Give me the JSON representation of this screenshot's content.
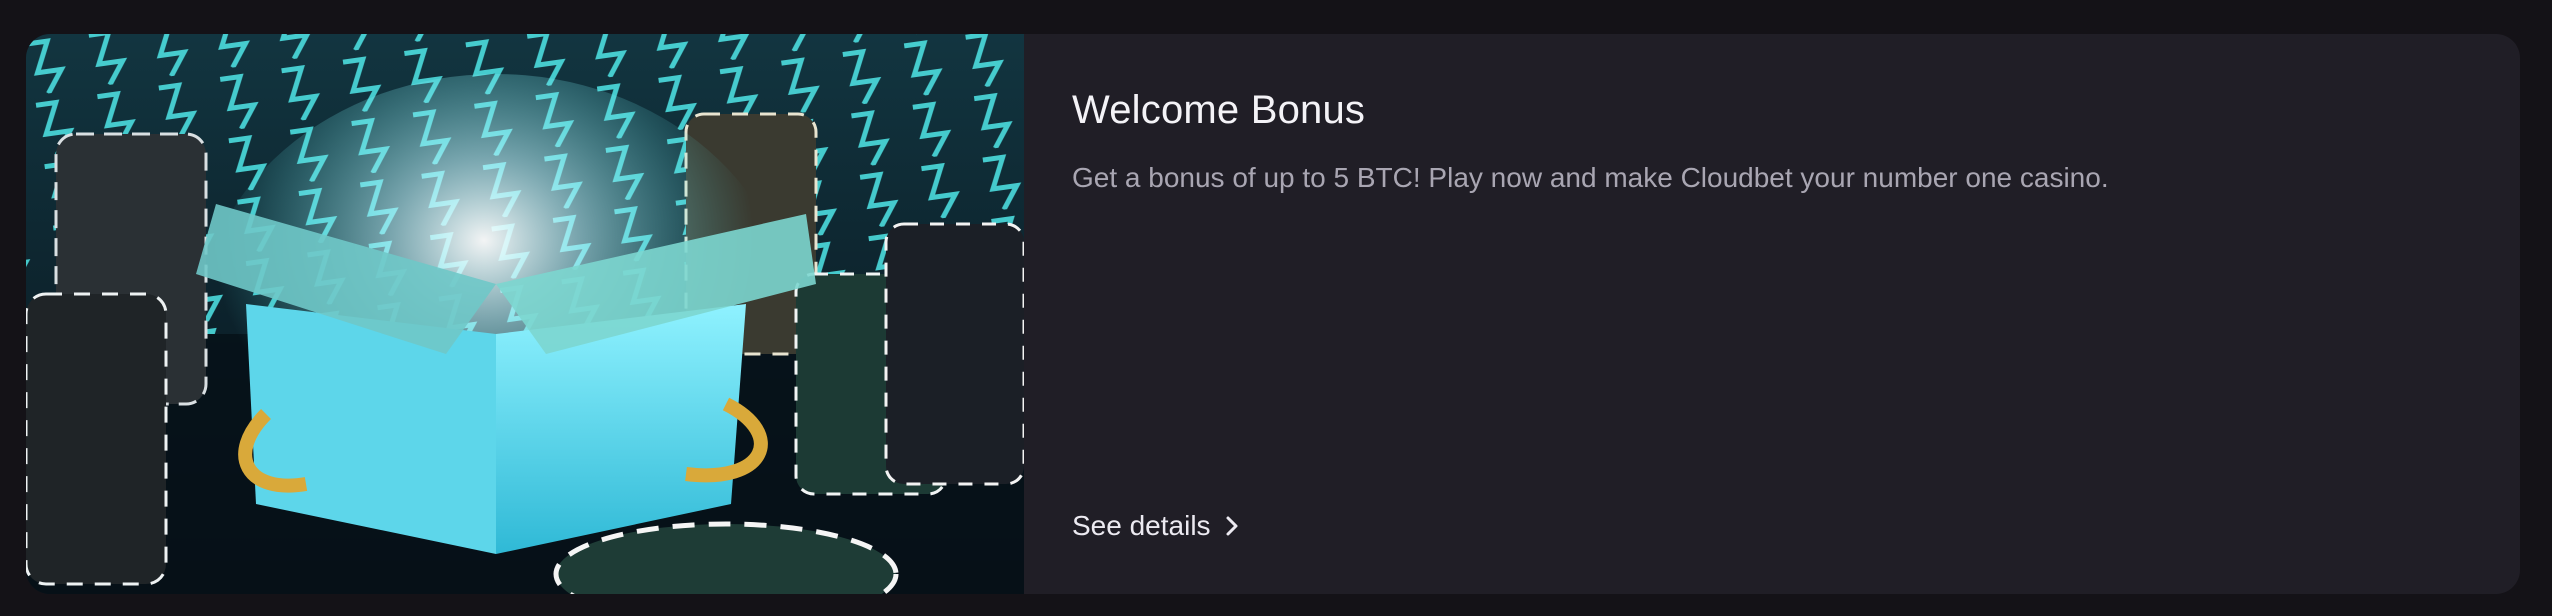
{
  "promo": {
    "title": "Welcome Bonus",
    "description": "Get a bonus of up to 5 BTC! Play now and make Cloudbet your number one casino.",
    "link_label": "See details",
    "link_icon": "chevron-right-icon",
    "image_alt": "glowing gift box with casino chip stacks"
  },
  "colors": {
    "page_bg": "#141217",
    "card_bg": "#201e26",
    "title": "#f4f3f7",
    "description": "#a9a6b2",
    "accent_neon": "#4fe6e8"
  }
}
